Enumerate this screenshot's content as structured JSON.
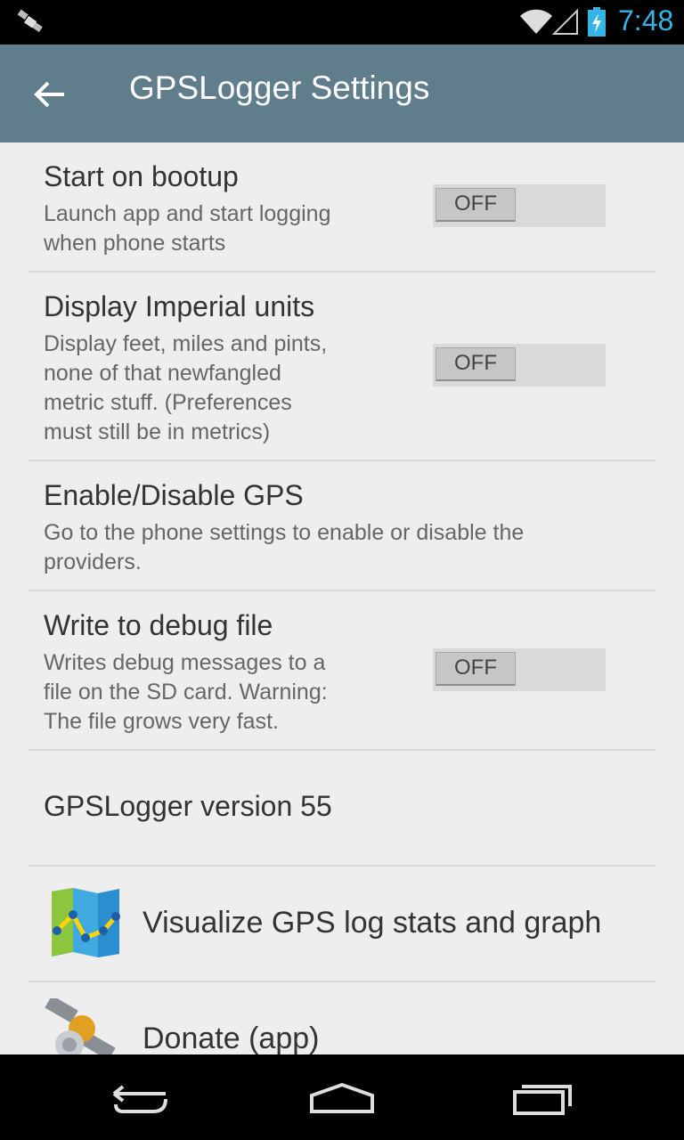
{
  "status_bar": {
    "time": "7:48",
    "color": "#33b5e5"
  },
  "action_bar": {
    "title": "GPSLogger Settings",
    "background": "#607d8b"
  },
  "preferences": [
    {
      "title": "Start on bootup",
      "summary": [
        "Launch app and start logging",
        "when phone starts"
      ],
      "toggle": "OFF"
    },
    {
      "title": "Display Imperial units",
      "summary": [
        "Display feet, miles and pints,",
        "none of that newfangled",
        "metric stuff. (Preferences",
        "must still be in metrics)"
      ],
      "toggle": "OFF"
    },
    {
      "title": "Enable/Disable GPS",
      "summary": [
        "Go to the phone settings to enable or disable the",
        "providers."
      ]
    },
    {
      "title": "Write to debug file",
      "summary": [
        "Writes debug messages to a",
        "file on the SD card. Warning:",
        "The file grows very fast."
      ],
      "toggle": "OFF"
    }
  ],
  "version_label": "GPSLogger version 55",
  "links": [
    {
      "label": "Visualize GPS log stats and graph",
      "icon": "map-graph-icon"
    },
    {
      "label": "Donate (app)",
      "icon": "satellite-icon"
    }
  ],
  "nav_bar": {
    "back": "back-icon",
    "home": "home-icon",
    "recents": "recents-icon"
  }
}
